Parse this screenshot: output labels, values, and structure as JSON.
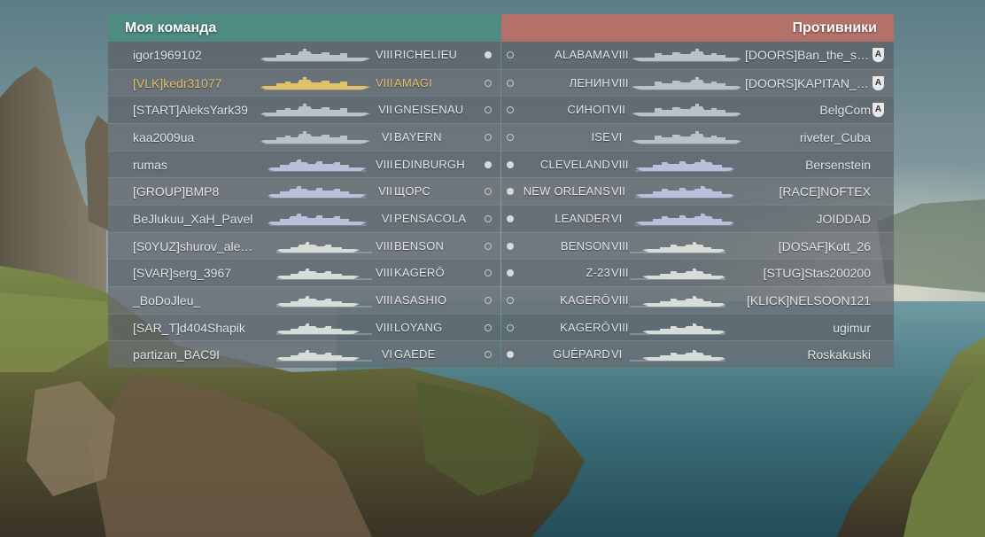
{
  "left_team": {
    "title": "Моя команда",
    "rows": [
      {
        "player": "igor1969102",
        "tier": "VIII",
        "ship": "RICHELIEU",
        "class": "bb",
        "status": "alive",
        "player_self": false
      },
      {
        "player": "[VLK]kedr31077",
        "tier": "VIII",
        "ship": "AMAGI",
        "class": "bb",
        "status": "empty",
        "player_self": true
      },
      {
        "player": "[START]AleksYark39",
        "tier": "VII",
        "ship": "GNEISENAU",
        "class": "bb",
        "status": "empty",
        "player_self": false
      },
      {
        "player": "kaa2009ua",
        "tier": "VI",
        "ship": "BAYERN",
        "class": "bb",
        "status": "empty",
        "player_self": false
      },
      {
        "player": "rumas",
        "tier": "VIII",
        "ship": "EDINBURGH",
        "class": "cr",
        "status": "alive",
        "player_self": false
      },
      {
        "player": "[GROUP]BMP8",
        "tier": "VII",
        "ship": "ЩОРС",
        "class": "cr",
        "status": "empty",
        "player_self": false
      },
      {
        "player": "BeJlukuu_XaH_Pavel",
        "tier": "VI",
        "ship": "PENSACOLA",
        "class": "cr",
        "status": "empty",
        "player_self": false
      },
      {
        "player": "[S0YUZ]shurov_alek...",
        "tier": "VIII",
        "ship": "BENSON",
        "class": "dd",
        "status": "empty",
        "player_self": false
      },
      {
        "player": "[SVAR]serg_3967",
        "tier": "VIII",
        "ship": "KAGERŌ",
        "class": "dd",
        "status": "empty",
        "player_self": false
      },
      {
        "player": "_BoDoJleu_",
        "tier": "VIII",
        "ship": "ASASHIO",
        "class": "dd",
        "status": "empty",
        "player_self": false
      },
      {
        "player": "[SAR_T]d404Shapik",
        "tier": "VIII",
        "ship": "LOYANG",
        "class": "dd",
        "status": "empty",
        "player_self": false
      },
      {
        "player": "partizan_BAC9I",
        "tier": "VI",
        "ship": "GAEDE",
        "class": "dd",
        "status": "empty",
        "player_self": false
      }
    ]
  },
  "right_team": {
    "title": "Противники",
    "rows": [
      {
        "player": "[DOORS]Ban_the_sin...",
        "tier": "VIII",
        "ship": "ALABAMA",
        "class": "bb",
        "status": "empty",
        "division": "A"
      },
      {
        "player": "[DOORS]KAPITAN_K...",
        "tier": "VIII",
        "ship": "ЛЕНИН",
        "class": "bb",
        "status": "empty",
        "division": "A"
      },
      {
        "player": "BelgCom",
        "tier": "VII",
        "ship": "СИНОП",
        "class": "bb",
        "status": "empty",
        "division": "A"
      },
      {
        "player": "riveter_Cuba",
        "tier": "VI",
        "ship": "ISE",
        "class": "bb",
        "status": "empty",
        "division": ""
      },
      {
        "player": "Bersenstein",
        "tier": "VIII",
        "ship": "CLEVELAND",
        "class": "cr",
        "status": "alive",
        "division": ""
      },
      {
        "player": "[RACE]NOFTEX",
        "tier": "VII",
        "ship": "NEW ORLEANS",
        "class": "cr",
        "status": "alive",
        "division": ""
      },
      {
        "player": "JOIDDAD",
        "tier": "VI",
        "ship": "LEANDER",
        "class": "cr",
        "status": "alive",
        "division": ""
      },
      {
        "player": "[DOSAF]Kott_26",
        "tier": "VIII",
        "ship": "BENSON",
        "class": "dd",
        "status": "alive",
        "division": ""
      },
      {
        "player": "[STUG]Stas200200",
        "tier": "VIII",
        "ship": "Z-23",
        "class": "dd",
        "status": "alive",
        "division": ""
      },
      {
        "player": "[KLICK]NELSOON121",
        "tier": "VIII",
        "ship": "KAGERŌ",
        "class": "dd",
        "status": "empty",
        "division": ""
      },
      {
        "player": "ugimur",
        "tier": "VIII",
        "ship": "KAGERŌ",
        "class": "dd",
        "status": "empty",
        "division": ""
      },
      {
        "player": "Roskakuski",
        "tier": "VI",
        "ship": "GUÉPARD",
        "class": "dd",
        "status": "alive",
        "division": ""
      }
    ]
  },
  "colors": {
    "ally_header": "#4d8b83",
    "enemy_header": "#b4716a",
    "self_highlight": "#e6c06c",
    "ship_bb_ally": "#bcc1c6",
    "ship_self": "#e0c06a",
    "ship_cr": "#b8c0dc",
    "ship_dd": "#d6ddd8"
  }
}
